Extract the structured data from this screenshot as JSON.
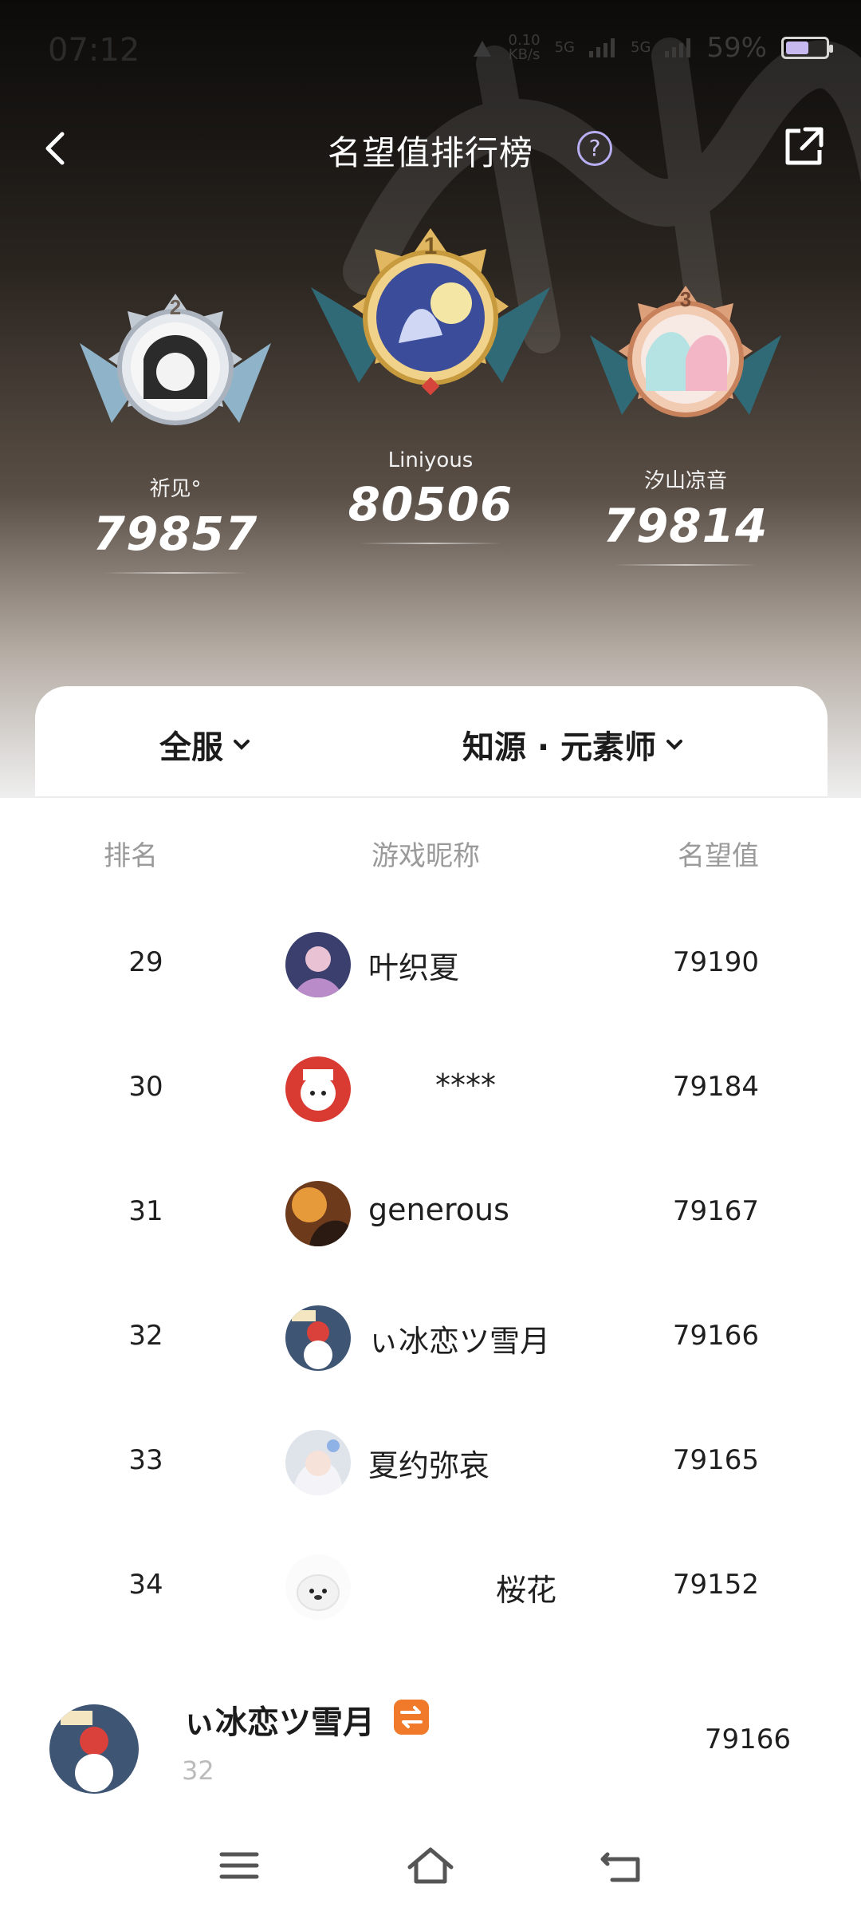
{
  "status_bar": {
    "time": "07:12",
    "net_speed_value": "0.10",
    "net_speed_unit": "KB/s",
    "sim1": "5G",
    "sim2": "5G",
    "battery": "59%",
    "battery_level": 0.59
  },
  "header": {
    "title": "名望值排行榜",
    "help_label": "?"
  },
  "podium": [
    {
      "place": "2",
      "name": "祈见°",
      "score": "79857"
    },
    {
      "place": "1",
      "name": "Liniyous",
      "score": "80506"
    },
    {
      "place": "3",
      "name": "汐山凉音",
      "score": "79814"
    }
  ],
  "filters": {
    "server": "全服",
    "class": "知源 · 元素师"
  },
  "table": {
    "headers": {
      "rank": "排名",
      "nickname": "游戏昵称",
      "value": "名望值"
    },
    "rows": [
      {
        "rank": "29",
        "nickname": "叶织夏",
        "value": "79190"
      },
      {
        "rank": "30",
        "nickname": "****",
        "value": "79184"
      },
      {
        "rank": "31",
        "nickname": "generous",
        "value": "79167"
      },
      {
        "rank": "32",
        "nickname": "ぃ冰恋ツ雪月",
        "value": "79166"
      },
      {
        "rank": "33",
        "nickname": "夏约弥哀",
        "value": "79165"
      },
      {
        "rank": "34",
        "nickname": "桜花",
        "value": "79152"
      }
    ]
  },
  "me": {
    "name": "ぃ冰恋ツ雪月",
    "rank": "32",
    "value": "79166"
  },
  "colors": {
    "gold": "#d9a74a",
    "silver": "#b9c3cf",
    "bronze": "#d3926b",
    "accent_orange": "#f07a2a"
  }
}
